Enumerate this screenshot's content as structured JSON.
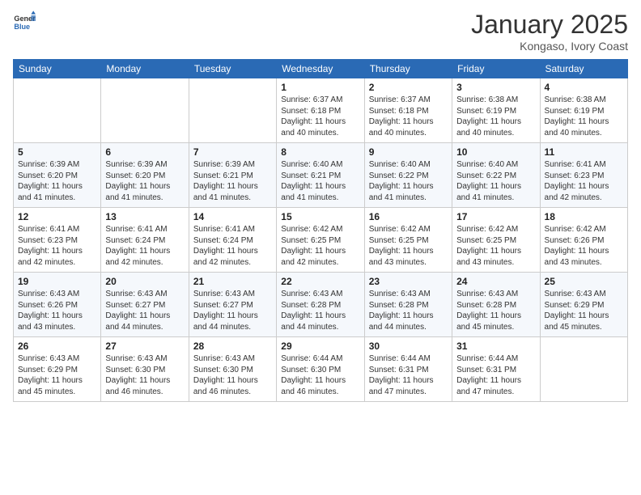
{
  "header": {
    "logo_general": "General",
    "logo_blue": "Blue",
    "title": "January 2025",
    "location": "Kongaso, Ivory Coast"
  },
  "days_of_week": [
    "Sunday",
    "Monday",
    "Tuesday",
    "Wednesday",
    "Thursday",
    "Friday",
    "Saturday"
  ],
  "weeks": [
    [
      {
        "day": "",
        "sunrise": "",
        "sunset": "",
        "daylight": ""
      },
      {
        "day": "",
        "sunrise": "",
        "sunset": "",
        "daylight": ""
      },
      {
        "day": "",
        "sunrise": "",
        "sunset": "",
        "daylight": ""
      },
      {
        "day": "1",
        "sunrise": "Sunrise: 6:37 AM",
        "sunset": "Sunset: 6:18 PM",
        "daylight": "Daylight: 11 hours and 40 minutes."
      },
      {
        "day": "2",
        "sunrise": "Sunrise: 6:37 AM",
        "sunset": "Sunset: 6:18 PM",
        "daylight": "Daylight: 11 hours and 40 minutes."
      },
      {
        "day": "3",
        "sunrise": "Sunrise: 6:38 AM",
        "sunset": "Sunset: 6:19 PM",
        "daylight": "Daylight: 11 hours and 40 minutes."
      },
      {
        "day": "4",
        "sunrise": "Sunrise: 6:38 AM",
        "sunset": "Sunset: 6:19 PM",
        "daylight": "Daylight: 11 hours and 40 minutes."
      }
    ],
    [
      {
        "day": "5",
        "sunrise": "Sunrise: 6:39 AM",
        "sunset": "Sunset: 6:20 PM",
        "daylight": "Daylight: 11 hours and 41 minutes."
      },
      {
        "day": "6",
        "sunrise": "Sunrise: 6:39 AM",
        "sunset": "Sunset: 6:20 PM",
        "daylight": "Daylight: 11 hours and 41 minutes."
      },
      {
        "day": "7",
        "sunrise": "Sunrise: 6:39 AM",
        "sunset": "Sunset: 6:21 PM",
        "daylight": "Daylight: 11 hours and 41 minutes."
      },
      {
        "day": "8",
        "sunrise": "Sunrise: 6:40 AM",
        "sunset": "Sunset: 6:21 PM",
        "daylight": "Daylight: 11 hours and 41 minutes."
      },
      {
        "day": "9",
        "sunrise": "Sunrise: 6:40 AM",
        "sunset": "Sunset: 6:22 PM",
        "daylight": "Daylight: 11 hours and 41 minutes."
      },
      {
        "day": "10",
        "sunrise": "Sunrise: 6:40 AM",
        "sunset": "Sunset: 6:22 PM",
        "daylight": "Daylight: 11 hours and 41 minutes."
      },
      {
        "day": "11",
        "sunrise": "Sunrise: 6:41 AM",
        "sunset": "Sunset: 6:23 PM",
        "daylight": "Daylight: 11 hours and 42 minutes."
      }
    ],
    [
      {
        "day": "12",
        "sunrise": "Sunrise: 6:41 AM",
        "sunset": "Sunset: 6:23 PM",
        "daylight": "Daylight: 11 hours and 42 minutes."
      },
      {
        "day": "13",
        "sunrise": "Sunrise: 6:41 AM",
        "sunset": "Sunset: 6:24 PM",
        "daylight": "Daylight: 11 hours and 42 minutes."
      },
      {
        "day": "14",
        "sunrise": "Sunrise: 6:41 AM",
        "sunset": "Sunset: 6:24 PM",
        "daylight": "Daylight: 11 hours and 42 minutes."
      },
      {
        "day": "15",
        "sunrise": "Sunrise: 6:42 AM",
        "sunset": "Sunset: 6:25 PM",
        "daylight": "Daylight: 11 hours and 42 minutes."
      },
      {
        "day": "16",
        "sunrise": "Sunrise: 6:42 AM",
        "sunset": "Sunset: 6:25 PM",
        "daylight": "Daylight: 11 hours and 43 minutes."
      },
      {
        "day": "17",
        "sunrise": "Sunrise: 6:42 AM",
        "sunset": "Sunset: 6:25 PM",
        "daylight": "Daylight: 11 hours and 43 minutes."
      },
      {
        "day": "18",
        "sunrise": "Sunrise: 6:42 AM",
        "sunset": "Sunset: 6:26 PM",
        "daylight": "Daylight: 11 hours and 43 minutes."
      }
    ],
    [
      {
        "day": "19",
        "sunrise": "Sunrise: 6:43 AM",
        "sunset": "Sunset: 6:26 PM",
        "daylight": "Daylight: 11 hours and 43 minutes."
      },
      {
        "day": "20",
        "sunrise": "Sunrise: 6:43 AM",
        "sunset": "Sunset: 6:27 PM",
        "daylight": "Daylight: 11 hours and 44 minutes."
      },
      {
        "day": "21",
        "sunrise": "Sunrise: 6:43 AM",
        "sunset": "Sunset: 6:27 PM",
        "daylight": "Daylight: 11 hours and 44 minutes."
      },
      {
        "day": "22",
        "sunrise": "Sunrise: 6:43 AM",
        "sunset": "Sunset: 6:28 PM",
        "daylight": "Daylight: 11 hours and 44 minutes."
      },
      {
        "day": "23",
        "sunrise": "Sunrise: 6:43 AM",
        "sunset": "Sunset: 6:28 PM",
        "daylight": "Daylight: 11 hours and 44 minutes."
      },
      {
        "day": "24",
        "sunrise": "Sunrise: 6:43 AM",
        "sunset": "Sunset: 6:28 PM",
        "daylight": "Daylight: 11 hours and 45 minutes."
      },
      {
        "day": "25",
        "sunrise": "Sunrise: 6:43 AM",
        "sunset": "Sunset: 6:29 PM",
        "daylight": "Daylight: 11 hours and 45 minutes."
      }
    ],
    [
      {
        "day": "26",
        "sunrise": "Sunrise: 6:43 AM",
        "sunset": "Sunset: 6:29 PM",
        "daylight": "Daylight: 11 hours and 45 minutes."
      },
      {
        "day": "27",
        "sunrise": "Sunrise: 6:43 AM",
        "sunset": "Sunset: 6:30 PM",
        "daylight": "Daylight: 11 hours and 46 minutes."
      },
      {
        "day": "28",
        "sunrise": "Sunrise: 6:43 AM",
        "sunset": "Sunset: 6:30 PM",
        "daylight": "Daylight: 11 hours and 46 minutes."
      },
      {
        "day": "29",
        "sunrise": "Sunrise: 6:44 AM",
        "sunset": "Sunset: 6:30 PM",
        "daylight": "Daylight: 11 hours and 46 minutes."
      },
      {
        "day": "30",
        "sunrise": "Sunrise: 6:44 AM",
        "sunset": "Sunset: 6:31 PM",
        "daylight": "Daylight: 11 hours and 47 minutes."
      },
      {
        "day": "31",
        "sunrise": "Sunrise: 6:44 AM",
        "sunset": "Sunset: 6:31 PM",
        "daylight": "Daylight: 11 hours and 47 minutes."
      },
      {
        "day": "",
        "sunrise": "",
        "sunset": "",
        "daylight": ""
      }
    ]
  ]
}
